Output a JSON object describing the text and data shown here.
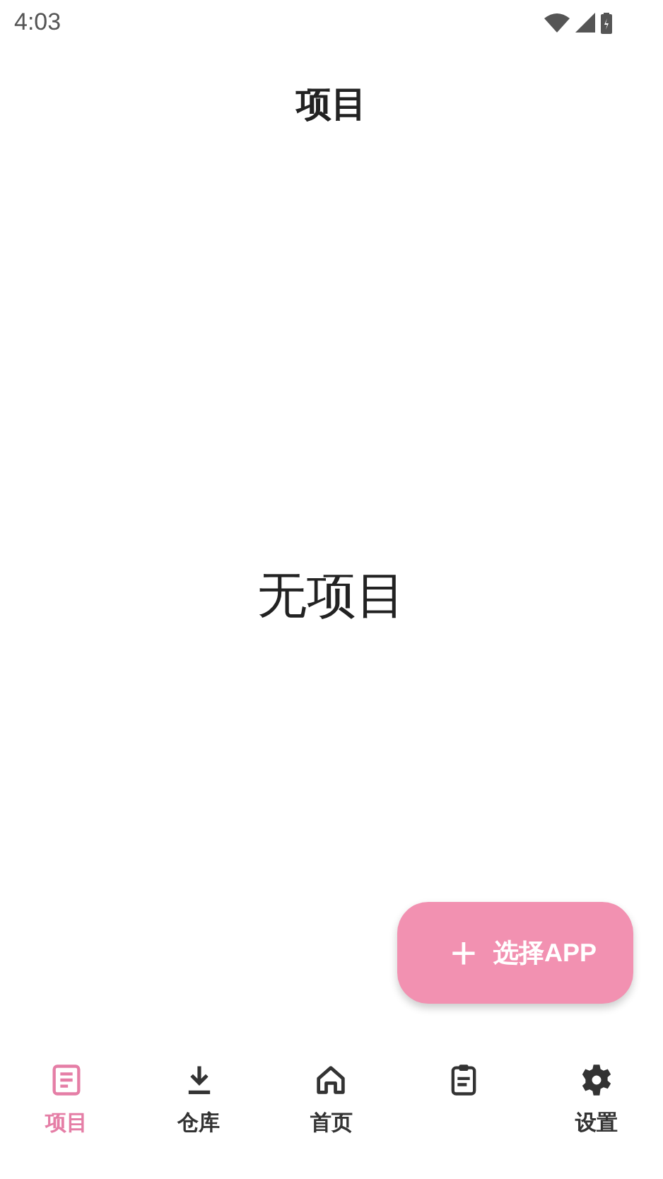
{
  "status_bar": {
    "time": "4:03"
  },
  "app_bar": {
    "title": "项目"
  },
  "empty_state": {
    "text": "无项目"
  },
  "fab": {
    "icon": "+",
    "label": "选择APP"
  },
  "bottom_nav": [
    {
      "kind": "list",
      "label": "项目",
      "selected": true
    },
    {
      "kind": "download",
      "label": "仓库",
      "selected": false
    },
    {
      "kind": "home",
      "label": "首页",
      "selected": false
    },
    {
      "kind": "clipboard",
      "selected": false
    },
    {
      "kind": "gear",
      "label": "设置",
      "selected": false
    }
  ]
}
